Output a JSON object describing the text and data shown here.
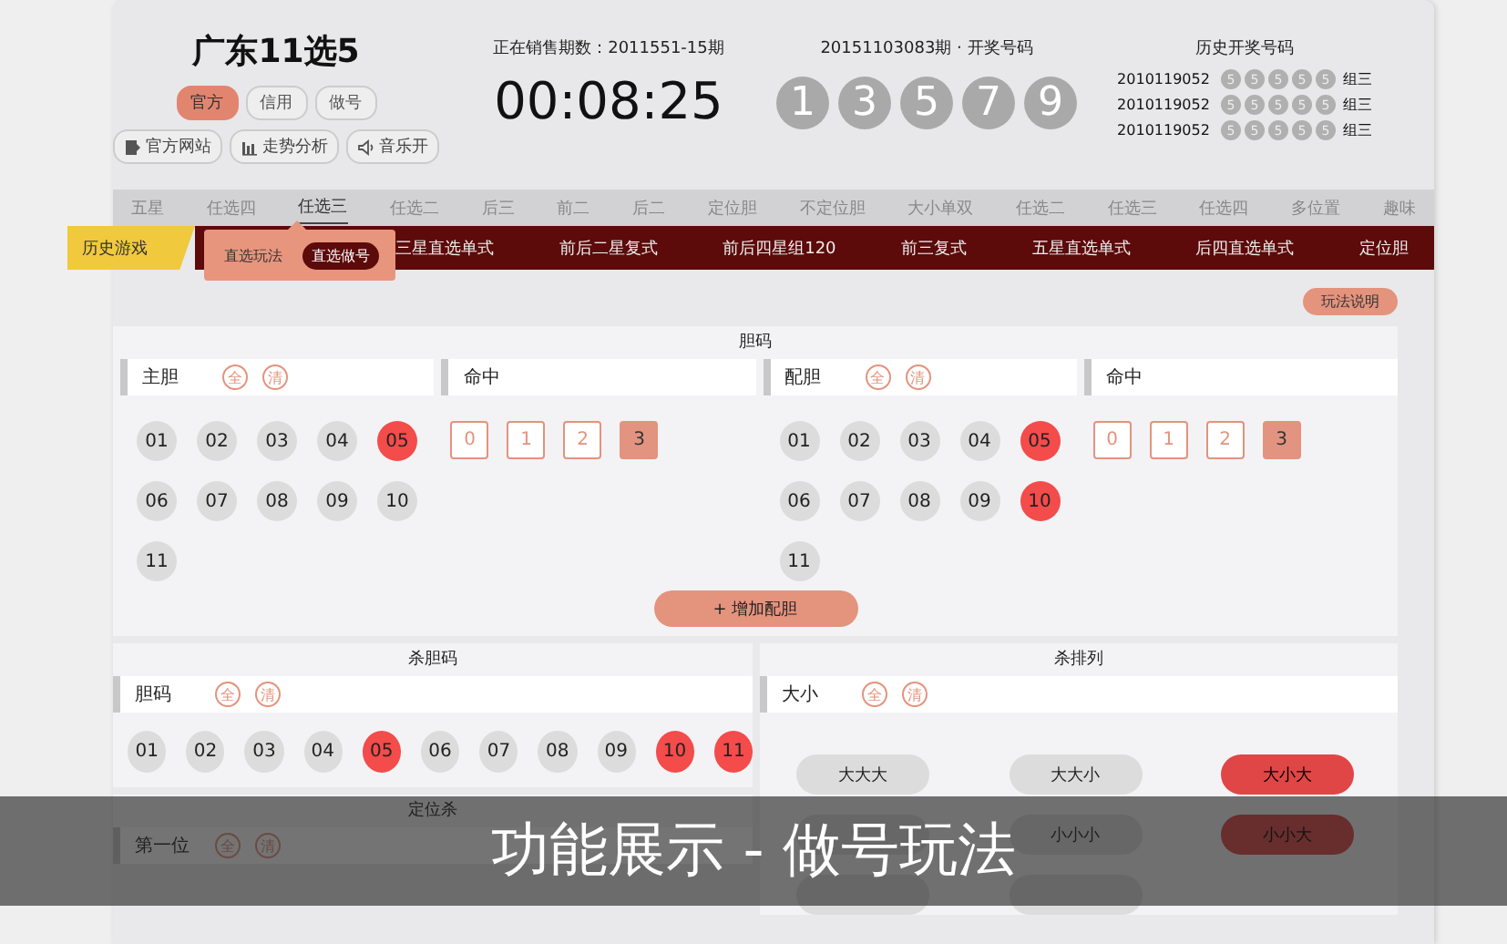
{
  "header": {
    "title": "广东11选5",
    "modes": [
      {
        "label": "官方",
        "selected": true
      },
      {
        "label": "信用",
        "selected": false
      },
      {
        "label": "做号",
        "selected": false
      }
    ],
    "links": [
      {
        "label": "官方网站",
        "kind": "site"
      },
      {
        "label": "走势分析",
        "kind": "chart"
      },
      {
        "label": "音乐开",
        "kind": "sound"
      }
    ]
  },
  "countdown": {
    "label": "正在销售期数：2011551-15期",
    "time": "00:08:25"
  },
  "draw": {
    "label": "20151103083期 · 开奖号码",
    "numbers": [
      "1",
      "3",
      "5",
      "7",
      "9"
    ]
  },
  "history": {
    "title": "历史开奖号码",
    "rows": [
      {
        "issue": "2010119052",
        "numbers": [
          "5",
          "5",
          "5",
          "5",
          "5"
        ],
        "type": "组三"
      },
      {
        "issue": "2010119052",
        "numbers": [
          "5",
          "5",
          "5",
          "5",
          "5"
        ],
        "type": "组三"
      },
      {
        "issue": "2010119052",
        "numbers": [
          "5",
          "5",
          "5",
          "5",
          "5"
        ],
        "type": "组三"
      }
    ]
  },
  "nav": {
    "items": [
      {
        "label": "五星",
        "selected": false
      },
      {
        "label": "任选四",
        "selected": false
      },
      {
        "label": "任选三",
        "selected": true
      },
      {
        "label": "任选二",
        "selected": false
      },
      {
        "label": "后三",
        "selected": false
      },
      {
        "label": "前二",
        "selected": false
      },
      {
        "label": "后二",
        "selected": false
      },
      {
        "label": "定位胆",
        "selected": false
      },
      {
        "label": "不定位胆",
        "selected": false
      },
      {
        "label": "大小单双",
        "selected": false
      },
      {
        "label": "任选二",
        "selected": false
      },
      {
        "label": "任选三",
        "selected": false
      },
      {
        "label": "任选四",
        "selected": false
      },
      {
        "label": "多位置",
        "selected": false
      },
      {
        "label": "趣味",
        "selected": false
      }
    ]
  },
  "subnav": {
    "tab": "历史游戏",
    "items": [
      "三星直选单式",
      "前后二星复式",
      "前后四星组120",
      "前三复式",
      "五星直选单式",
      "后四直选单式",
      "定位胆"
    ]
  },
  "popup": {
    "options": [
      {
        "label": "直选玩法",
        "selected": false
      },
      {
        "label": "直选做号",
        "selected": true
      }
    ]
  },
  "help_button": "玩法说明",
  "dan_panel": {
    "title": "胆码",
    "groups": [
      {
        "kind": "balls",
        "label": "主胆",
        "all": "全",
        "clear": "清",
        "balls": [
          {
            "label": "01",
            "selected": false
          },
          {
            "label": "02",
            "selected": false
          },
          {
            "label": "03",
            "selected": false
          },
          {
            "label": "04",
            "selected": false
          },
          {
            "label": "05",
            "selected": true
          },
          {
            "label": "06",
            "selected": false
          },
          {
            "label": "07",
            "selected": false
          },
          {
            "label": "08",
            "selected": false
          },
          {
            "label": "09",
            "selected": false
          },
          {
            "label": "10",
            "selected": false
          },
          {
            "label": "11",
            "selected": false
          }
        ]
      },
      {
        "kind": "hits",
        "label": "命中",
        "hits": [
          {
            "label": "0",
            "selected": false
          },
          {
            "label": "1",
            "selected": false
          },
          {
            "label": "2",
            "selected": false
          },
          {
            "label": "3",
            "selected": true
          }
        ]
      },
      {
        "kind": "balls",
        "label": "配胆",
        "all": "全",
        "clear": "清",
        "balls": [
          {
            "label": "01",
            "selected": false
          },
          {
            "label": "02",
            "selected": false
          },
          {
            "label": "03",
            "selected": false
          },
          {
            "label": "04",
            "selected": false
          },
          {
            "label": "05",
            "selected": true
          },
          {
            "label": "06",
            "selected": false
          },
          {
            "label": "07",
            "selected": false
          },
          {
            "label": "08",
            "selected": false
          },
          {
            "label": "09",
            "selected": false
          },
          {
            "label": "10",
            "selected": true
          },
          {
            "label": "11",
            "selected": false
          }
        ]
      },
      {
        "kind": "hits",
        "label": "命中",
        "hits": [
          {
            "label": "0",
            "selected": false
          },
          {
            "label": "1",
            "selected": false
          },
          {
            "label": "2",
            "selected": false
          },
          {
            "label": "3",
            "selected": true
          }
        ]
      }
    ],
    "add_button": "+ 增加配胆"
  },
  "kill_panel": {
    "title": "杀胆码",
    "label": "胆码",
    "all": "全",
    "clear": "清",
    "balls": [
      {
        "label": "01",
        "selected": false
      },
      {
        "label": "02",
        "selected": false
      },
      {
        "label": "03",
        "selected": false
      },
      {
        "label": "04",
        "selected": false
      },
      {
        "label": "05",
        "selected": true
      },
      {
        "label": "06",
        "selected": false
      },
      {
        "label": "07",
        "selected": false
      },
      {
        "label": "08",
        "selected": false
      },
      {
        "label": "09",
        "selected": false
      },
      {
        "label": "10",
        "selected": true
      },
      {
        "label": "11",
        "selected": true
      }
    ]
  },
  "position_panel": {
    "title": "定位杀",
    "label": "第一位",
    "all": "全",
    "clear": "清"
  },
  "arrange_panel": {
    "title": "杀排列",
    "label": "大小",
    "all": "全",
    "clear": "清",
    "options": [
      {
        "label": "大大大",
        "selected": false
      },
      {
        "label": "大大小",
        "selected": false
      },
      {
        "label": "大小大",
        "selected": true
      },
      {
        "selected": false
      },
      {
        "label": "小小小",
        "selected": false
      },
      {
        "label": "小小大",
        "selected": true
      },
      {
        "selected": false
      },
      {
        "selected": false
      }
    ]
  },
  "caption": "功能展示 - 做号玩法"
}
